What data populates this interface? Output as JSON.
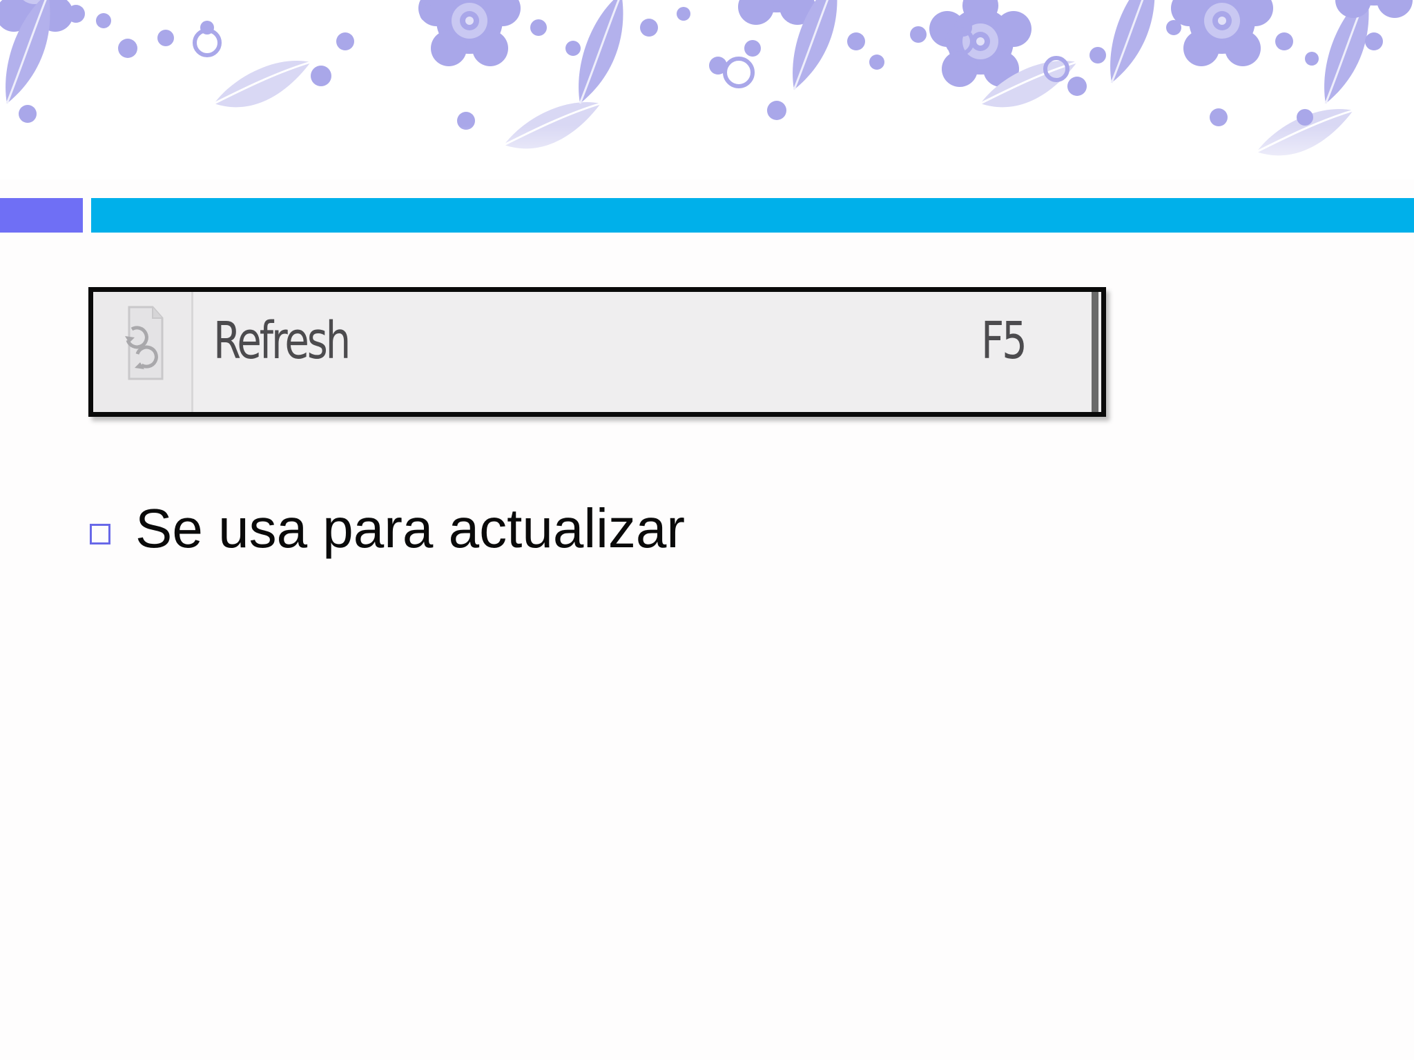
{
  "slide": {
    "accent_colors": {
      "left_bar": "#6f6ff5",
      "right_bar": "#00b0ea",
      "bullet": "#6868e8",
      "floral": "#a6a6e8"
    }
  },
  "menu_item": {
    "icon": "refresh-page-icon",
    "label": "Refresh",
    "shortcut": "F5"
  },
  "bullets": [
    {
      "text": "Se usa para actualizar"
    }
  ]
}
